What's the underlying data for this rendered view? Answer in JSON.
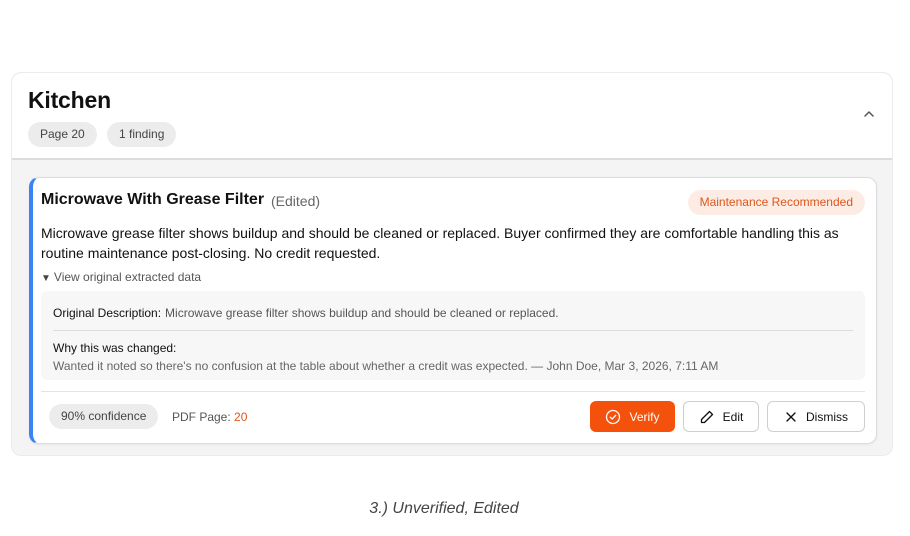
{
  "section": {
    "title": "Kitchen",
    "page_chip": "Page 20",
    "finding_chip": "1 finding",
    "collapse_icon": "chevron-up-icon"
  },
  "finding": {
    "title": "Microwave With Grease Filter",
    "edited_label": "(Edited)",
    "status": "Maintenance Recommended",
    "description": "Microwave grease filter shows buildup and should be cleaned or replaced. Buyer confirmed they are comfortable handling this as routine maintenance post-closing. No credit requested.",
    "toggle_label": "View original extracted data",
    "original": {
      "label": "Original Description:",
      "text": "Microwave grease filter shows buildup and should be cleaned or replaced.",
      "why_label": "Why this was changed:",
      "why_text": "Wanted it noted so there's no confusion at the table about whether a credit was expected. — John Doe, Mar 3, 2026, 7:11 AM"
    },
    "confidence": "90% confidence",
    "pdf_page_label": "PDF Page:",
    "pdf_page_value": "20",
    "actions": {
      "verify": "Verify",
      "edit": "Edit",
      "dismiss": "Dismiss"
    }
  },
  "caption": "3.) Unverified, Edited",
  "colors": {
    "accent": "#f4520c",
    "status_text": "#e0561c",
    "status_bg": "#fdece4",
    "card_border_left": "#3b82f6"
  }
}
